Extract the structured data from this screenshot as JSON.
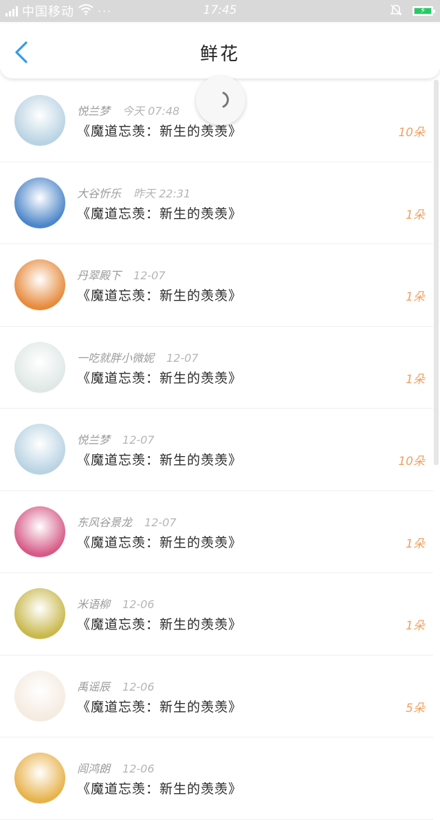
{
  "status_bar": {
    "carrier": "中国移动",
    "dots": "···",
    "time": "17:45"
  },
  "header": {
    "title": "鲜花"
  },
  "items": [
    {
      "user": "悦兰梦",
      "time": "今天 07:48",
      "book": "《魔道忘羡：新生的羡羡》",
      "count": "10朵",
      "avatar_color": "#b9d3e3"
    },
    {
      "user": "大谷忻乐",
      "time": "昨天 22:31",
      "book": "《魔道忘羡：新生的羡羡》",
      "count": "1朵",
      "avatar_color": "#4c86c9"
    },
    {
      "user": "丹翠殿下",
      "time": "12-07",
      "book": "《魔道忘羡：新生的羡羡》",
      "count": "1朵",
      "avatar_color": "#e78a3c"
    },
    {
      "user": "一吃就胖小微妮",
      "time": "12-07",
      "book": "《魔道忘羡：新生的羡羡》",
      "count": "1朵",
      "avatar_color": "#dfe8e6"
    },
    {
      "user": "悦兰梦",
      "time": "12-07",
      "book": "《魔道忘羡：新生的羡羡》",
      "count": "10朵",
      "avatar_color": "#b9d3e3"
    },
    {
      "user": "东风谷景龙",
      "time": "12-07",
      "book": "《魔道忘羡：新生的羡羡》",
      "count": "1朵",
      "avatar_color": "#d65a86"
    },
    {
      "user": "米语柳",
      "time": "12-06",
      "book": "《魔道忘羡：新生的羡羡》",
      "count": "1朵",
      "avatar_color": "#c9b84c"
    },
    {
      "user": "禹谣辰",
      "time": "12-06",
      "book": "《魔道忘羡：新生的羡羡》",
      "count": "5朵",
      "avatar_color": "#f5ebe0"
    },
    {
      "user": "闾鸿朗",
      "time": "12-06",
      "book": "《魔道忘羡：新生的羡羡》",
      "count": "",
      "avatar_color": "#e7b24a"
    }
  ]
}
